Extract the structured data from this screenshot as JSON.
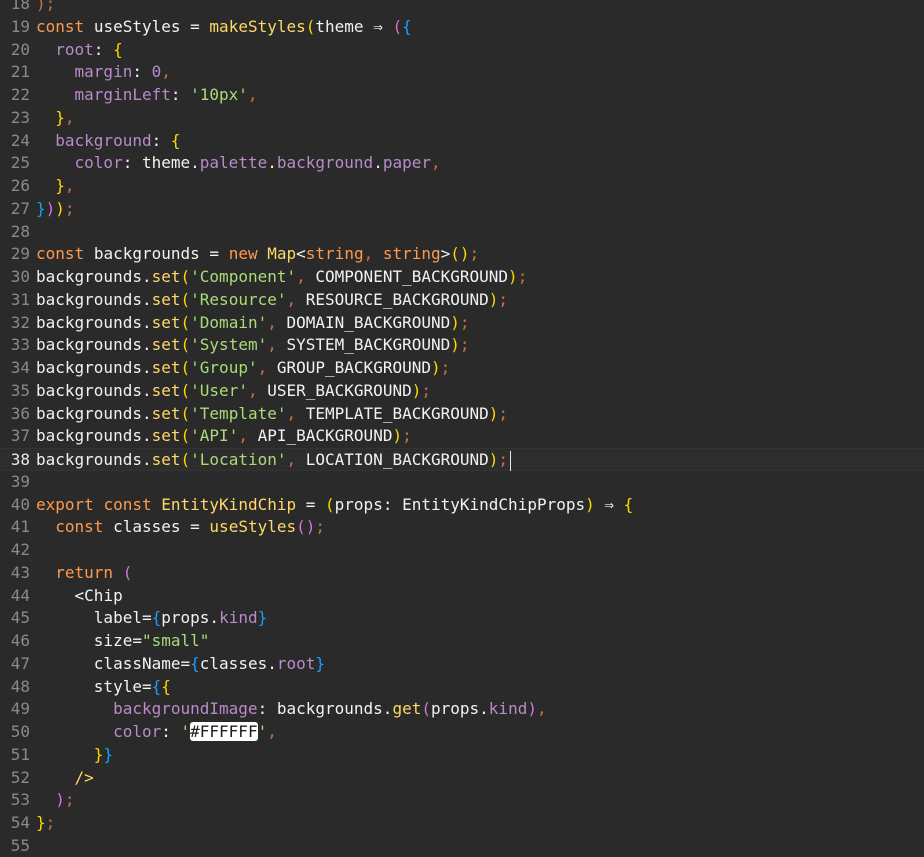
{
  "editor": {
    "current_line": "38",
    "lines": [
      {
        "n": "18"
      },
      {
        "n": "19"
      },
      {
        "n": "20"
      },
      {
        "n": "21"
      },
      {
        "n": "22"
      },
      {
        "n": "23"
      },
      {
        "n": "24"
      },
      {
        "n": "25"
      },
      {
        "n": "26"
      },
      {
        "n": "27"
      },
      {
        "n": "28"
      },
      {
        "n": "29"
      },
      {
        "n": "30"
      },
      {
        "n": "31"
      },
      {
        "n": "32"
      },
      {
        "n": "33"
      },
      {
        "n": "34"
      },
      {
        "n": "35"
      },
      {
        "n": "36"
      },
      {
        "n": "37"
      },
      {
        "n": "38"
      },
      {
        "n": "39"
      },
      {
        "n": "40"
      },
      {
        "n": "41"
      },
      {
        "n": "42"
      },
      {
        "n": "43"
      },
      {
        "n": "44"
      },
      {
        "n": "45"
      },
      {
        "n": "46"
      },
      {
        "n": "47"
      },
      {
        "n": "48"
      },
      {
        "n": "49"
      },
      {
        "n": "50"
      },
      {
        "n": "51"
      },
      {
        "n": "52"
      },
      {
        "n": "53"
      },
      {
        "n": "54"
      },
      {
        "n": "55"
      }
    ]
  },
  "tokens": {
    "const": "const",
    "useStyles": "useStyles",
    "eq": " = ",
    "makeStyles": "makeStyles",
    "theme": "theme",
    "arrow": " ⇒ ",
    "root": "root",
    "margin": "margin",
    "zero": "0",
    "marginLeft": "marginLeft",
    "str10px": "'10px'",
    "background": "background",
    "color": "color",
    "palette": "palette",
    "paper": "paper",
    "backgrounds": "backgrounds",
    "new": "new",
    "Map": "Map",
    "string": "string",
    "set": "set",
    "component_str": "'Component'",
    "component_const": "COMPONENT_BACKGROUND",
    "resource_str": "'Resource'",
    "resource_const": "RESOURCE_BACKGROUND",
    "domain_str": "'Domain'",
    "domain_const": "DOMAIN_BACKGROUND",
    "system_str": "'System'",
    "system_const": "SYSTEM_BACKGROUND",
    "group_str": "'Group'",
    "group_const": "GROUP_BACKGROUND",
    "user_str": "'User'",
    "user_const": "USER_BACKGROUND",
    "template_str": "'Template'",
    "template_const": "TEMPLATE_BACKGROUND",
    "api_str": "'API'",
    "api_const": "API_BACKGROUND",
    "location_str": "'Location'",
    "location_const": "LOCATION_BACKGROUND",
    "export": "export",
    "EntityKindChip": "EntityKindChip",
    "props": "props",
    "EntityKindChipProps": "EntityKindChipProps",
    "classes": "classes",
    "return": "return",
    "Chip": "Chip",
    "label": "label",
    "kind": "kind",
    "size": "size",
    "small_str": "\"small\"",
    "className": "className",
    "style": "style",
    "backgroundImage": "backgroundImage",
    "get": "get",
    "hex_open": "'",
    "hex": "#FFFFFF",
    "hex_close": "'"
  }
}
